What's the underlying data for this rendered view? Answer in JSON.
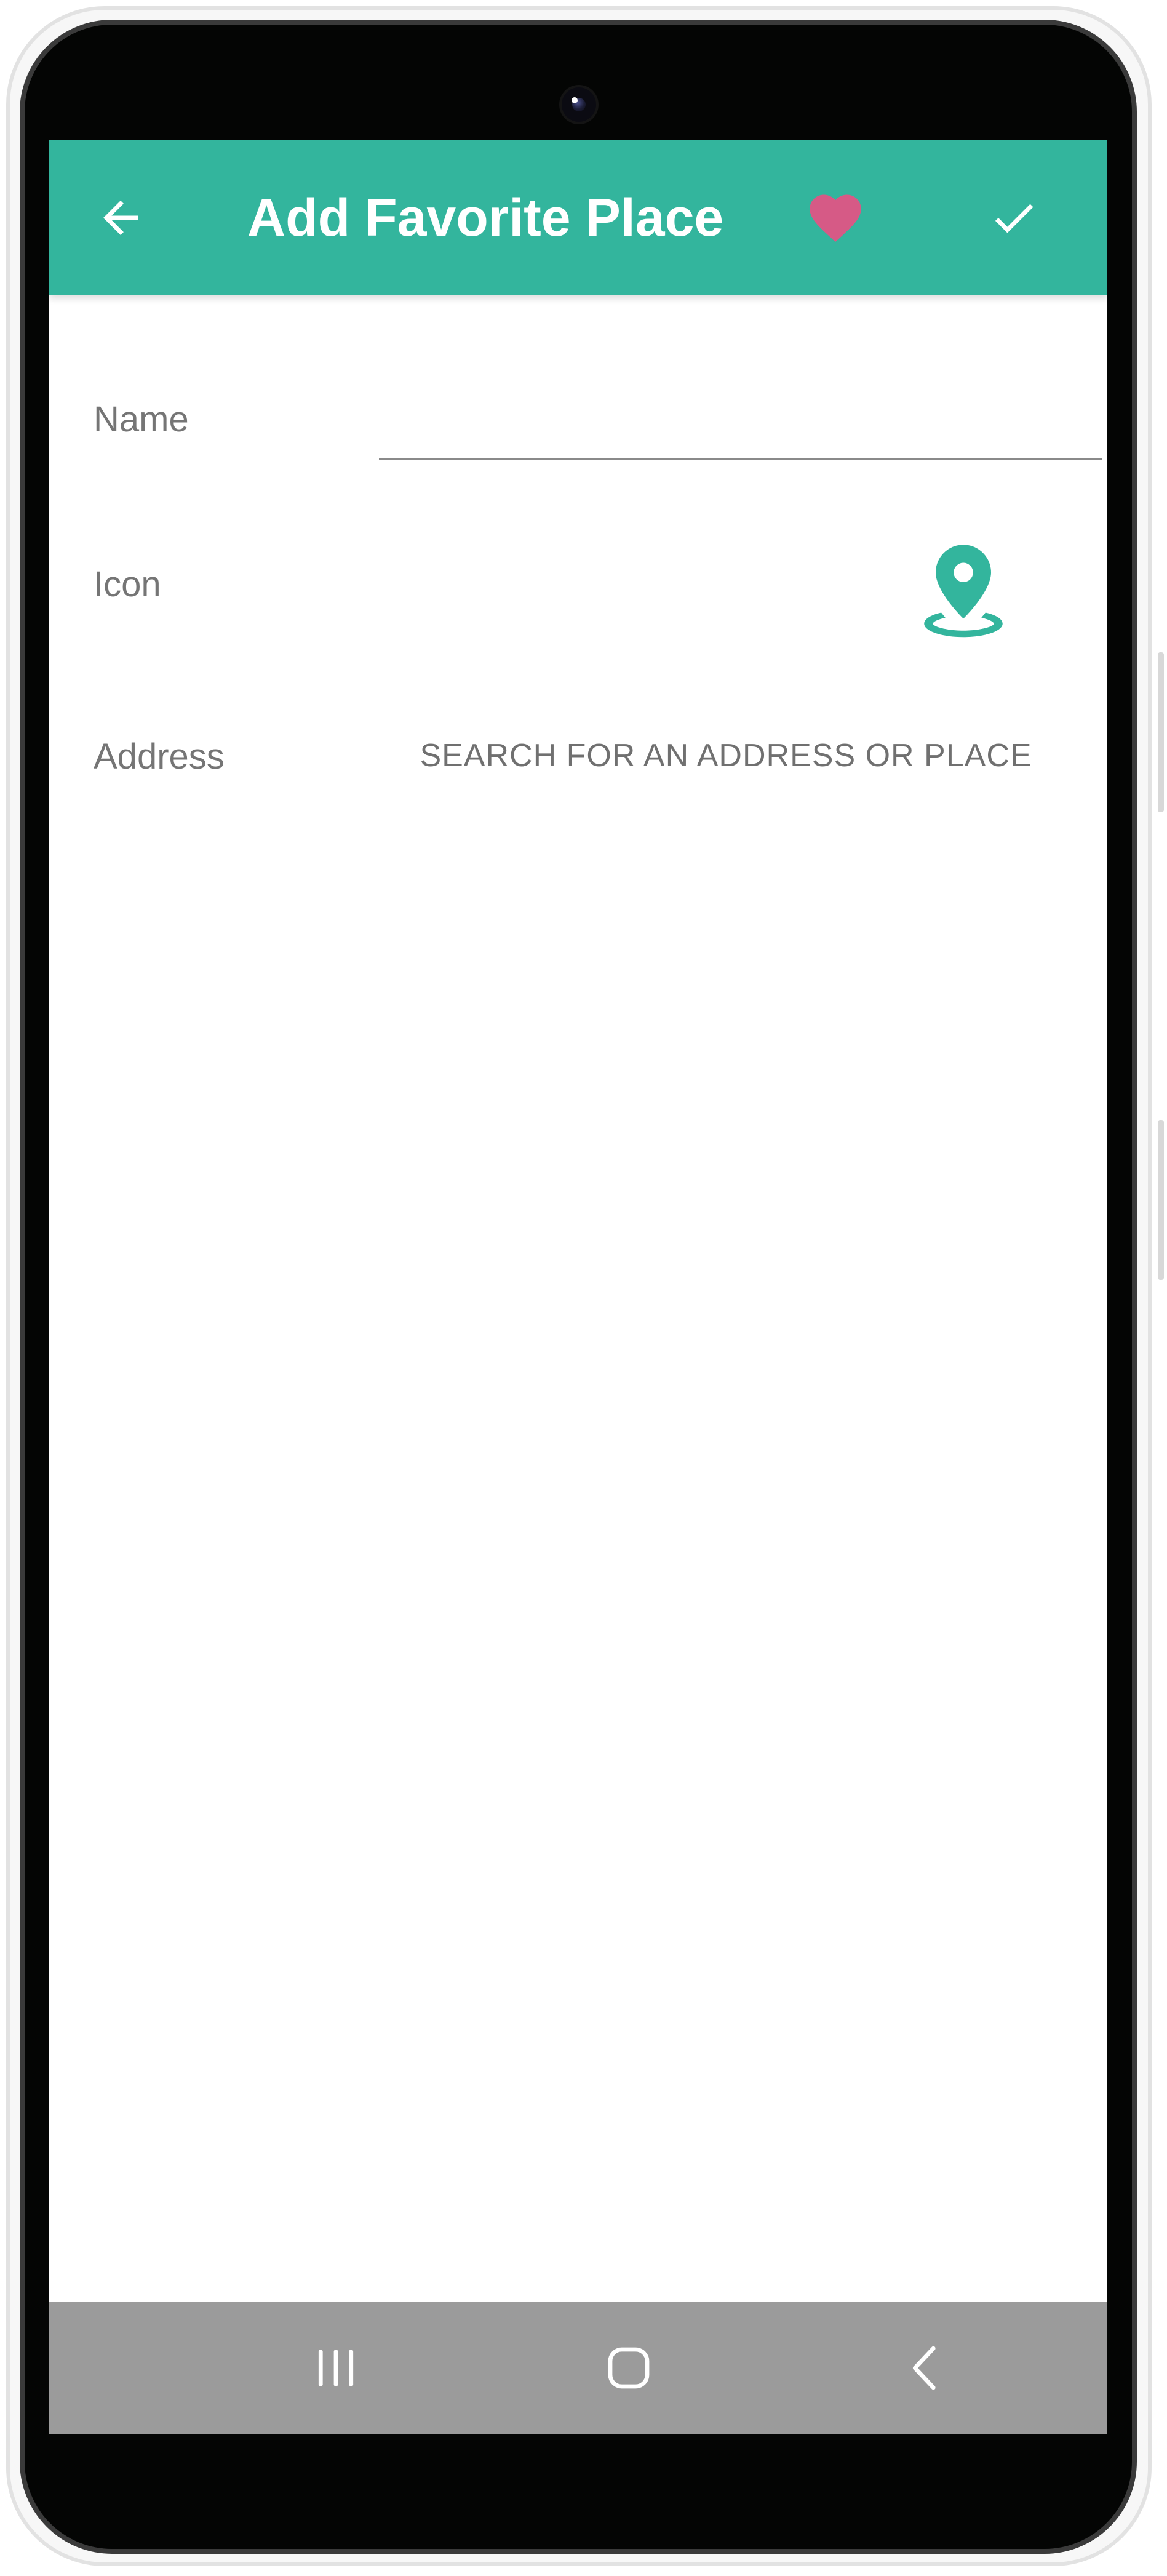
{
  "app_bar": {
    "title": "Add Favorite Place",
    "background_color": "#33b59d",
    "back_icon": "arrow-left-icon",
    "favorite_icon": "heart-icon",
    "favorite_color": "#d65a86",
    "confirm_icon": "checkmark-icon"
  },
  "form": {
    "name_label": "Name",
    "name_value": "",
    "icon_label": "Icon",
    "icon_name": "map-pin-icon",
    "icon_color": "#33b59d",
    "address_label": "Address",
    "address_button": "SEARCH FOR AN ADDRESS OR PLACE"
  },
  "nav_bar": {
    "recents_icon": "recents-icon",
    "home_icon": "home-icon",
    "back_icon": "nav-back-icon"
  }
}
